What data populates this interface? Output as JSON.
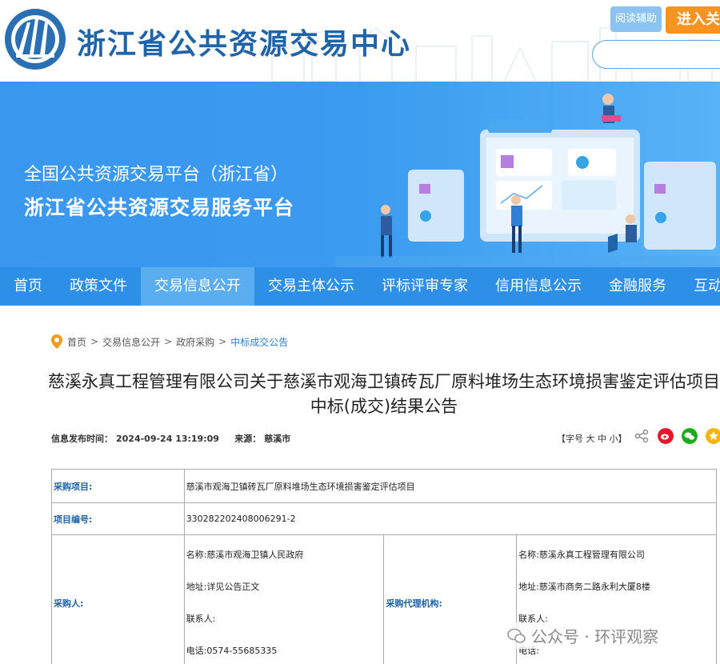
{
  "header": {
    "site_name": "浙江省公共资源交易中心",
    "read_assist": "阅读辅助",
    "enter_label": "进入关",
    "search_placeholder": ""
  },
  "banner": {
    "line1": "全国公共资源交易平台（浙江省）",
    "line2": "浙江省公共资源交易服务平台"
  },
  "nav": {
    "items": [
      "首页",
      "政策文件",
      "交易信息公开",
      "交易主体公示",
      "评标评审专家",
      "信用信息公示",
      "金融服务",
      "互动交流"
    ],
    "active_index": 2
  },
  "breadcrumb": {
    "items": [
      "首页",
      "交易信息公开",
      "政府采购",
      "中标成交公告"
    ],
    "separator": ">"
  },
  "article": {
    "title": "慈溪永真工程管理有限公司关于慈溪市观海卫镇砖瓦厂原料堆场生态环境损害鉴定评估项目中标(成交)结果公告",
    "publish_label": "信息发布时间：",
    "publish_time": "2024-09-24 13:19:09",
    "source_label": "来源：",
    "source": "慈溪市",
    "font_size_label": "【字号 大 中 小】"
  },
  "table": {
    "project_label": "采购项目:",
    "project_value": "慈溪市观海卫镇砖瓦厂原料堆场生态环境损害鉴定评估项目",
    "number_label": "项目编号:",
    "number_value": "330282202408006291-2",
    "purchaser_label": "采购人:",
    "purchaser_name": "名称:慈溪市观海卫镇人民政府",
    "purchaser_address": "地址:详见公告正文",
    "purchaser_contact": "联系人:",
    "purchaser_phone": "电话:0574-55685335",
    "agency_label": "采购代理机构:",
    "agency_name": "名称:慈溪永真工程管理有限公司",
    "agency_address": "地址:慈溪市商务二路永利大厦8楼",
    "agency_contact": "联系人:",
    "agency_phone": "电话:"
  },
  "watermark": "公众号 · 环评观察",
  "colors": {
    "brand_blue": "#1f63a8",
    "nav_blue": "#2e8fe6",
    "accent_orange": "#f7931e"
  }
}
